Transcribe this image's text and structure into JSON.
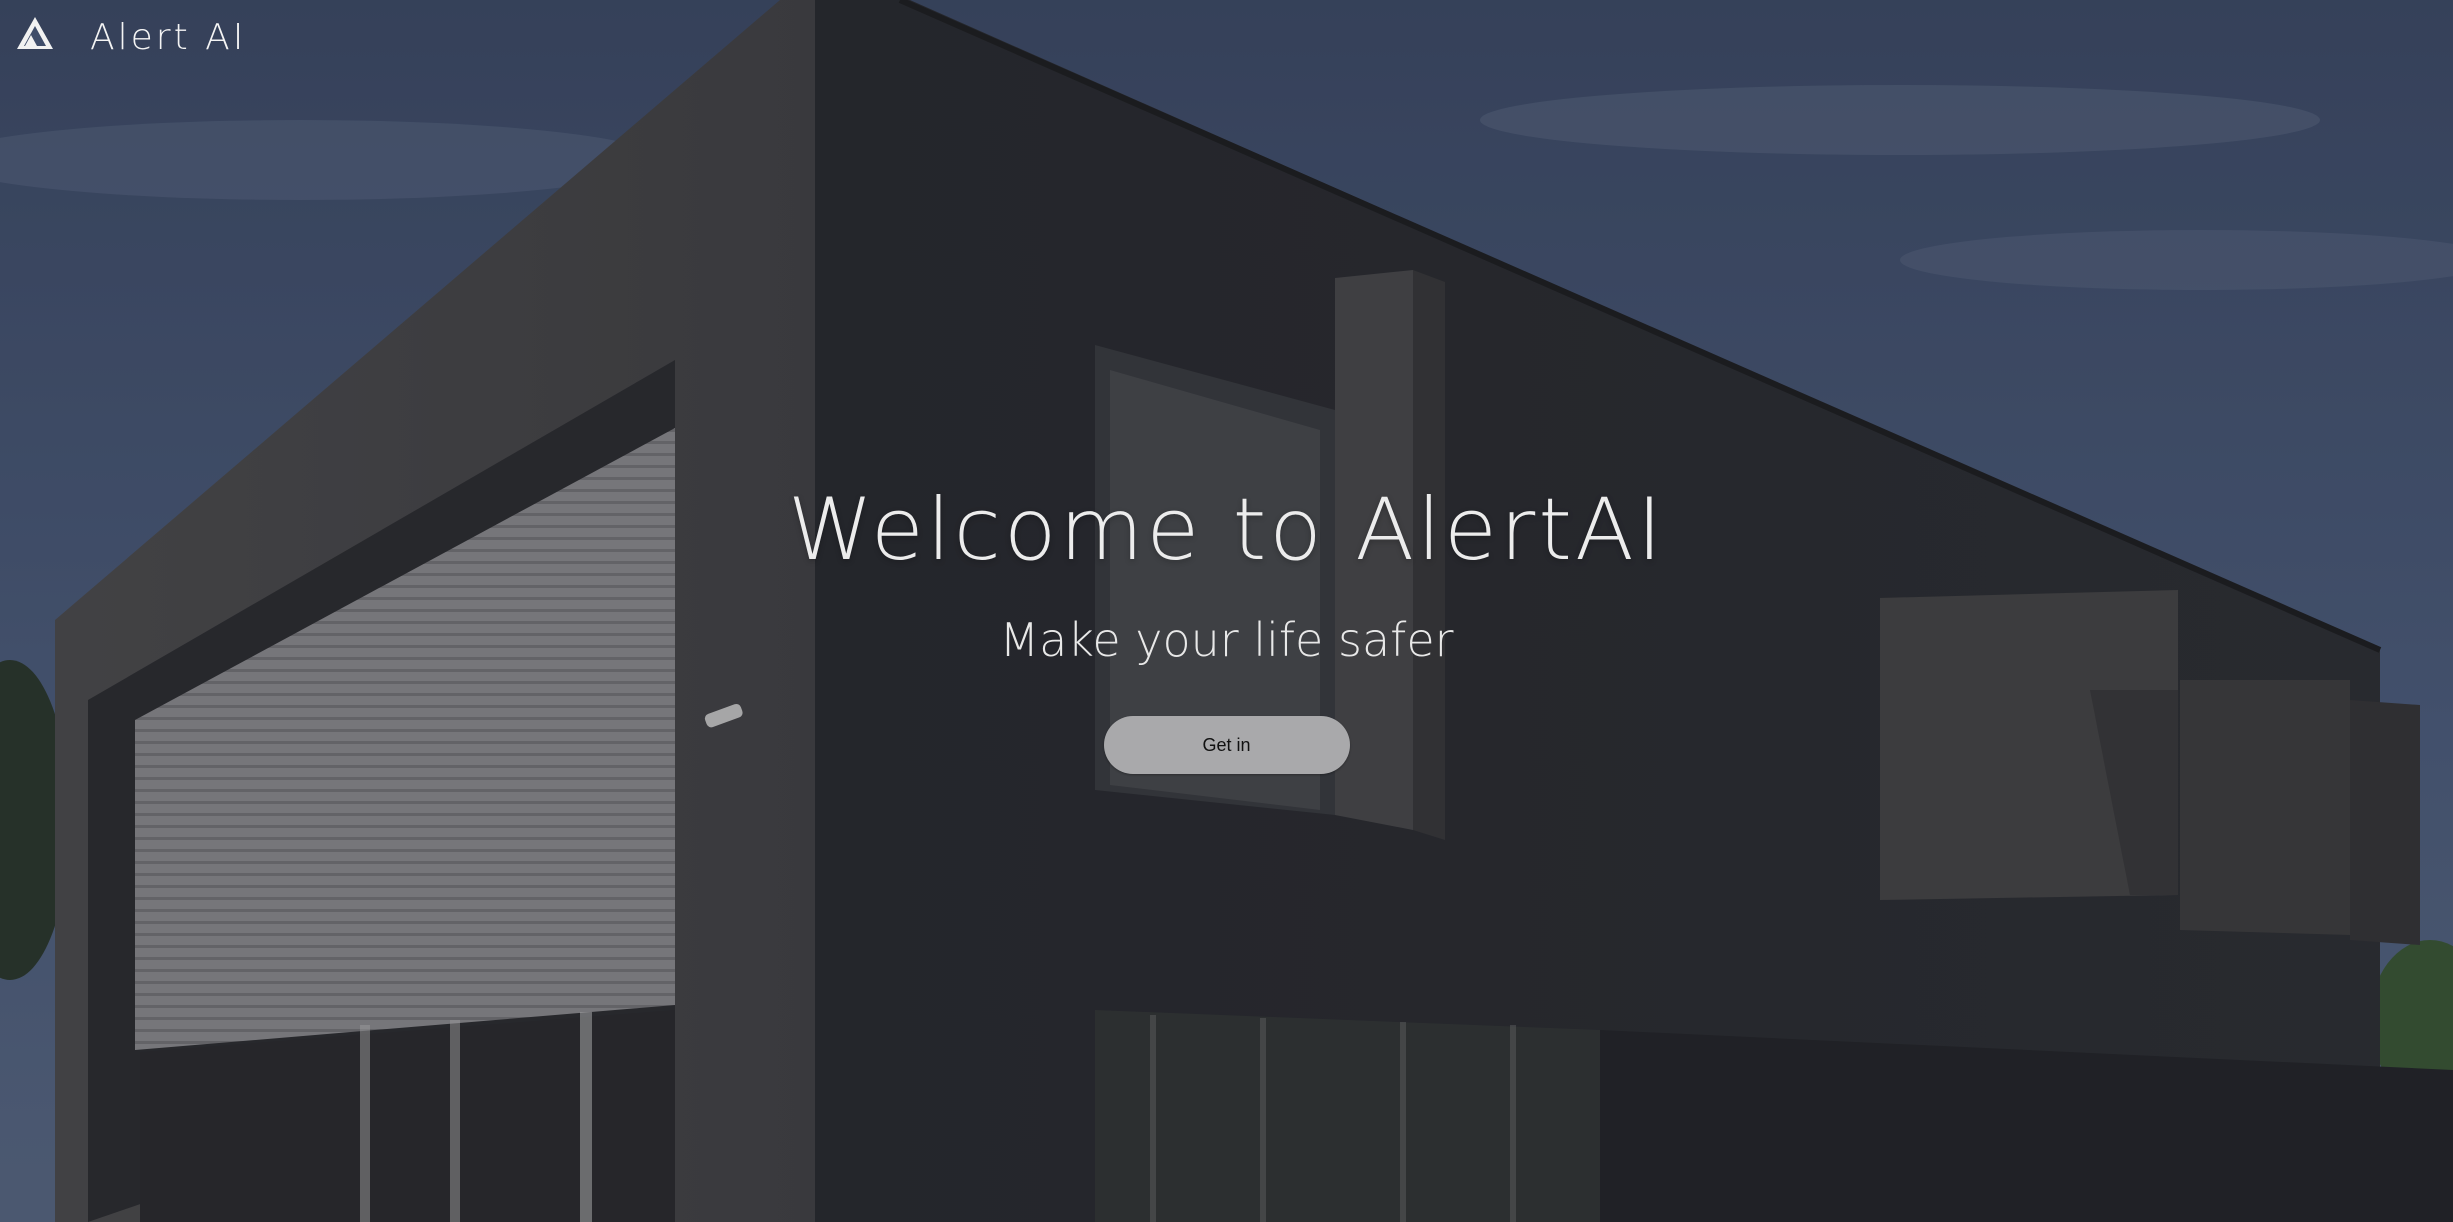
{
  "header": {
    "brand_name": "Alert AI",
    "logo_icon": "triangle-logo-icon"
  },
  "hero": {
    "title": "Welcome to AlertAI",
    "subtitle": "Make your life safer",
    "cta_label": "Get in"
  },
  "colors": {
    "text": "#ececec",
    "button_bg": "#a9a9ab",
    "button_text": "#111111",
    "sky": "#4a5a78"
  }
}
